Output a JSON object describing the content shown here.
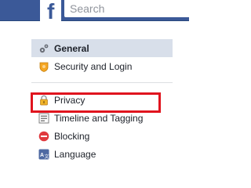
{
  "topbar": {
    "logo_letter": "f",
    "search_placeholder": "Search",
    "color": "#3b5998"
  },
  "menu": {
    "group1": [
      {
        "label": "General",
        "icon": "gear-icon",
        "active": true
      },
      {
        "label": "Security and Login",
        "icon": "security-badge-icon",
        "active": false
      }
    ],
    "group2": [
      {
        "label": "Privacy",
        "icon": "privacy-lock-icon",
        "active": false,
        "highlighted": true
      },
      {
        "label": "Timeline and Tagging",
        "icon": "timeline-icon",
        "active": false
      },
      {
        "label": "Blocking",
        "icon": "blocking-icon",
        "active": false
      },
      {
        "label": "Language",
        "icon": "language-icon",
        "active": false
      }
    ]
  },
  "colors": {
    "active_bg": "#d8dfea",
    "highlight_border": "#e0141e",
    "blocking_red": "#e0393e"
  }
}
